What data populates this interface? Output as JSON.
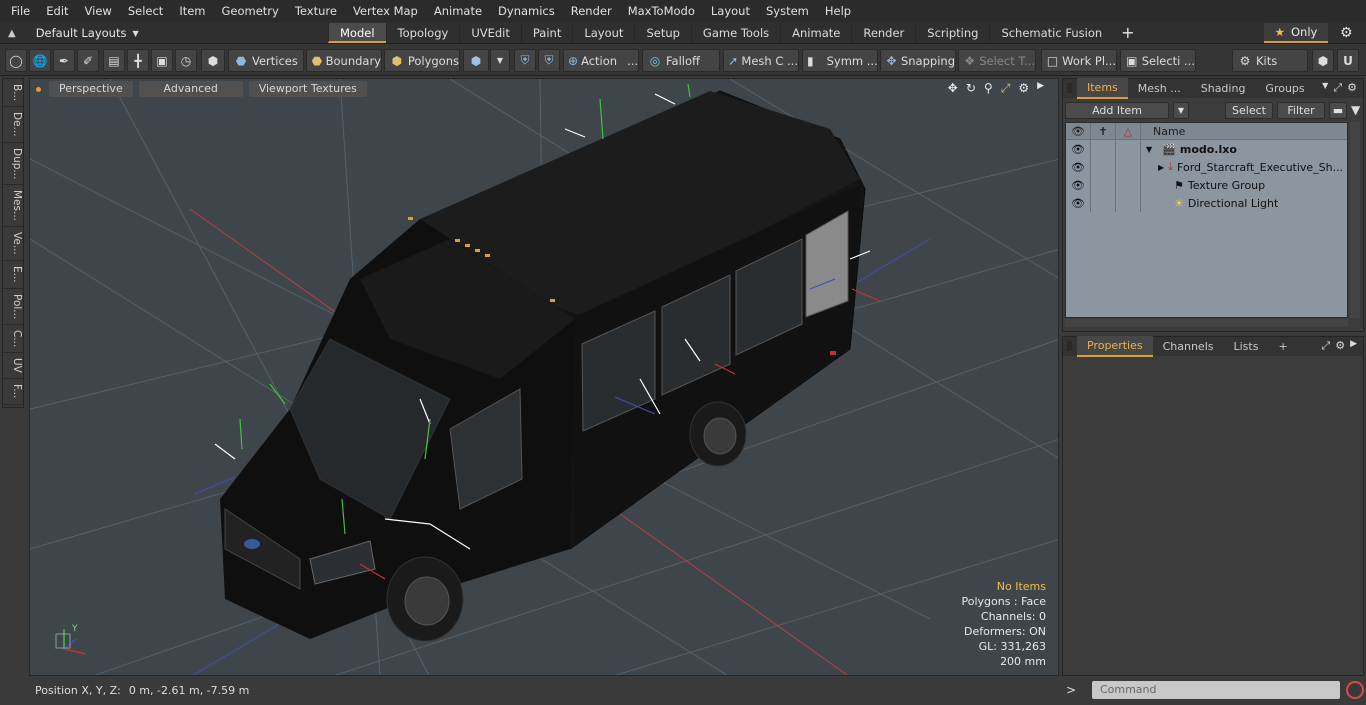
{
  "menu": [
    "File",
    "Edit",
    "View",
    "Select",
    "Item",
    "Geometry",
    "Texture",
    "Vertex Map",
    "Animate",
    "Dynamics",
    "Render",
    "MaxToModo",
    "Layout",
    "System",
    "Help"
  ],
  "layouts_label": "Default Layouts",
  "layout_tabs": [
    "Model",
    "Topology",
    "UVEdit",
    "Paint",
    "Layout",
    "Setup",
    "Game Tools",
    "Animate",
    "Render",
    "Scripting",
    "Schematic Fusion"
  ],
  "active_layout_tab": "Model",
  "only_label": "Only",
  "toolbar": {
    "vertices": "Vertices",
    "boundary": "Boundary",
    "polygons": "Polygons",
    "action": "Action",
    "falloff": "Falloff",
    "mesh_c": "Mesh C ...",
    "symm": "Symm ...",
    "snapping": "Snapping",
    "select_t": "Select T...",
    "work_pl": "Work Pl...",
    "selecti": "Selecti ...",
    "kits": "Kits"
  },
  "left_tabs": [
    "B...",
    "De...",
    "Dup...",
    "Mes...",
    "Ve...",
    "E...",
    "Pol...",
    "C...",
    "UV",
    "F..."
  ],
  "viewport": {
    "perspective": "Perspective",
    "advanced": "Advanced",
    "viewport_textures": "Viewport Textures",
    "stats": {
      "no_items": "No Items",
      "polygons": "Polygons : Face",
      "channels": "Channels: 0",
      "deformers": "Deformers: ON",
      "gl": "GL: 331,263",
      "scale": "200 mm"
    },
    "axis_y": "Y"
  },
  "status": {
    "position_label": "Position X, Y, Z:",
    "position_value": "0 m, -2.61 m, -7.59 m"
  },
  "items_panel": {
    "tabs": [
      "Items",
      "Mesh ...",
      "Shading",
      "Groups"
    ],
    "active_tab": "Items",
    "add_item": "Add Item",
    "select": "Select",
    "filter": "Filter",
    "name_col": "Name",
    "rows": [
      {
        "label": "modo.lxo",
        "bold": true
      },
      {
        "label": "Ford_Starcraft_Executive_Sh...",
        "bold": false
      },
      {
        "label": "Texture Group",
        "bold": false
      },
      {
        "label": "Directional Light",
        "bold": false
      }
    ]
  },
  "properties_panel": {
    "tabs": [
      "Properties",
      "Channels",
      "Lists"
    ],
    "active_tab": "Properties"
  },
  "command": {
    "placeholder": "Command"
  },
  "colors": {
    "accent": "#e09b34",
    "viewport_bg": "#3f464b",
    "tree_bg": "#8b969e"
  }
}
